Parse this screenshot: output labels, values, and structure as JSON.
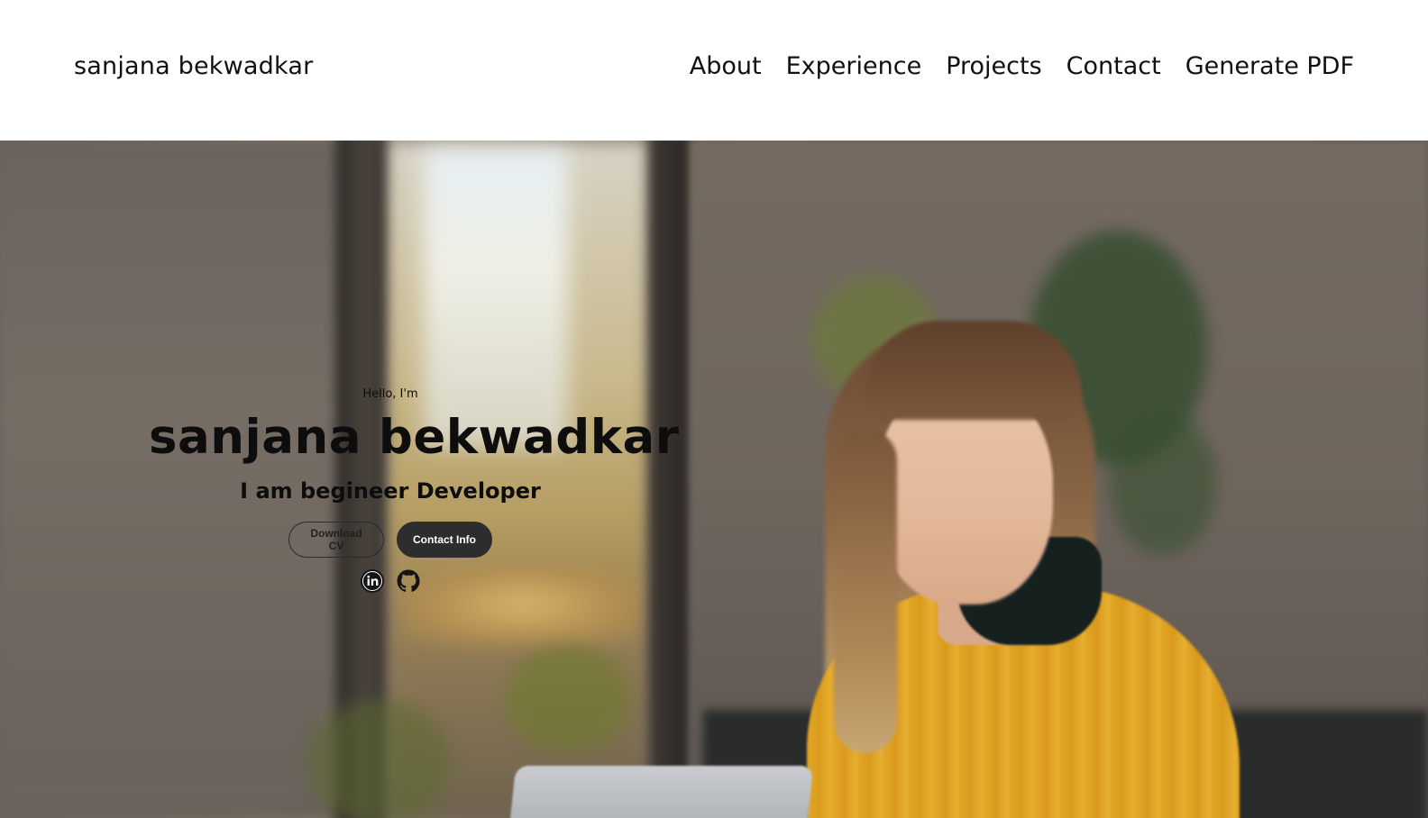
{
  "nav": {
    "brand": "sanjana bekwadkar",
    "links": [
      {
        "label": "About"
      },
      {
        "label": "Experience"
      },
      {
        "label": "Projects"
      },
      {
        "label": "Contact"
      },
      {
        "label": "Generate PDF"
      }
    ]
  },
  "hero": {
    "greeting": "Hello, I'm",
    "name": "sanjana bekwadkar",
    "tagline": "I am begineer Developer",
    "buttons": {
      "download_cv": "Download CV",
      "contact_info": "Contact Info"
    },
    "socials": [
      {
        "icon": "linkedin-icon"
      },
      {
        "icon": "github-icon"
      }
    ]
  },
  "colors": {
    "nav_bg": "#ffffff",
    "text": "#111111",
    "button_dark": "#2d2d2d",
    "sweater_yellow": "#e0a424"
  }
}
